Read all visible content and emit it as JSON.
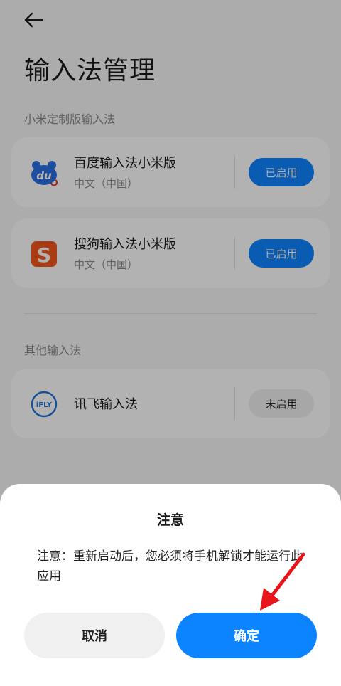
{
  "header": {
    "back_icon": "back-arrow-icon",
    "title": "输入法管理"
  },
  "sections": {
    "custom": {
      "label": "小米定制版输入法"
    },
    "other": {
      "label": "其他输入法"
    }
  },
  "keyboards": [
    {
      "name": "百度输入法小米版",
      "language": "中文（中国）",
      "status": "已启用",
      "icon": "baidu-du-icon"
    },
    {
      "name": "搜狗输入法小米版",
      "language": "中文（中国）",
      "status": "已启用",
      "icon": "sogou-s-icon"
    },
    {
      "name": "讯飞输入法",
      "status": "未启用",
      "icon": "iflytek-ifly-icon",
      "icon_text": "iFLY"
    }
  ],
  "dialog": {
    "title": "注意",
    "message": "注意：重新启动后，您必须将手机解锁才能运行此应用",
    "cancel_label": "取消",
    "confirm_label": "确定"
  },
  "colors": {
    "accent": "#0d84ff",
    "annotation_arrow": "#e8161b",
    "baidu_blue": "#2a6fe3",
    "sogou_orange": "#f2571d"
  }
}
